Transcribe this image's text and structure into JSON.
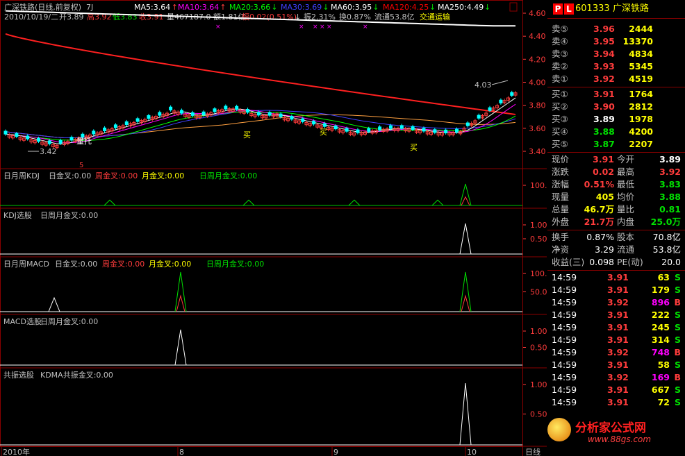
{
  "main": {
    "title": "广深铁路(日线,前复权)",
    "suffix": "7J",
    "ma_items": [
      {
        "label": "MA5:3.64",
        "color": "#ffffff",
        "arrow": "↑"
      },
      {
        "label": "MA10:3.64",
        "color": "#ff00ff",
        "arrow": "↑"
      },
      {
        "label": "MA20:3.66",
        "color": "#00ff00",
        "arrow": "↓"
      },
      {
        "label": "MA30:3.69",
        "color": "#0000ff",
        "arrow": "↓"
      },
      {
        "label": "MA60:3.95",
        "color": "#ffffff",
        "arrow": "↓"
      },
      {
        "label": "MA120:4.25",
        "color": "#ff0000",
        "arrow": "↓"
      },
      {
        "label": "MA250:4.49",
        "color": "#ffffff",
        "arrow": "↓"
      }
    ],
    "info_line": [
      {
        "text": "2010/10/19/二",
        "color": "#c0c0c0"
      },
      {
        "text": "开3.89",
        "color": "#c0c0c0"
      },
      {
        "text": "高3.92",
        "color": "#ff3c3c"
      },
      {
        "text": "低3.83",
        "color": "#00e000"
      },
      {
        "text": "收3.91",
        "color": "#ff3c3c"
      },
      {
        "text": "量467187.0",
        "color": "#c0c0c0"
      },
      {
        "text": "额1.81亿",
        "color": "#c0c0c0"
      },
      {
        "text": "幅0.02(0.51%)",
        "color": "#ff3c3c"
      },
      {
        "text": "↓",
        "color": "#c0c0c0"
      },
      {
        "text": "振2.31%",
        "color": "#c0c0c0"
      },
      {
        "text": "换0.87%",
        "color": "#c0c0c0"
      },
      {
        "text": "流通53.8亿",
        "color": "#c0c0c0"
      },
      {
        "text": "交通运输",
        "color": "#ffff00"
      }
    ],
    "y_ticks": [
      "4.60",
      "4.40",
      "4.20",
      "4.00",
      "3.80",
      "3.60",
      "3.40"
    ],
    "annotations": {
      "high": "4.03",
      "low": "3.42",
      "zhuo_tuo": "量托",
      "buy1": "买",
      "buy2": "买",
      "buy3": "买",
      "low_mark": "5"
    }
  },
  "panels": [
    {
      "title": "日月周KDJ",
      "items": [
        {
          "text": "日金叉:0.00",
          "color": "#c0c0c0"
        },
        {
          "text": "周金叉:0.00",
          "color": "#ff3c3c"
        },
        {
          "text": "月金叉:0.00",
          "color": "#ffff00"
        },
        {
          "text": "日周月金叉:0.00",
          "color": "#00e000"
        }
      ],
      "ticks": [
        "100.0"
      ]
    },
    {
      "title": "KDJ选股",
      "items": [
        {
          "text": "日周月金叉:0.00",
          "color": "#c0c0c0"
        }
      ],
      "ticks": [
        "1.00",
        "0.50"
      ]
    },
    {
      "title": "日月周MACD",
      "items": [
        {
          "text": "日金叉:0.00",
          "color": "#c0c0c0"
        },
        {
          "text": "周金叉:0.00",
          "color": "#ff3c3c"
        },
        {
          "text": "月金叉:0.00",
          "color": "#ffff00"
        },
        {
          "text": "日周月金叉:0.00",
          "color": "#00e000"
        }
      ],
      "ticks": [
        "100.0",
        "50.00"
      ]
    },
    {
      "title": "MACD选股",
      "items": [
        {
          "text": "日周月金叉:0.00",
          "color": "#c0c0c0"
        }
      ],
      "ticks": [
        "1.00",
        "0.50"
      ]
    },
    {
      "title": "共振选股",
      "items": [
        {
          "text": "KDMA共振金叉:0.00",
          "color": "#c0c0c0"
        }
      ],
      "ticks": [
        "1.00",
        "0.50"
      ]
    }
  ],
  "x_axis": {
    "labels": [
      "2010年",
      "8",
      "9",
      "10"
    ],
    "period": "日线"
  },
  "quote": {
    "badges": [
      "P",
      "L"
    ],
    "code": "601333",
    "name": "广深铁路",
    "asks": [
      {
        "label": "卖⑤",
        "price": "3.96",
        "vol": "2444"
      },
      {
        "label": "卖④",
        "price": "3.95",
        "vol": "13370"
      },
      {
        "label": "卖③",
        "price": "3.94",
        "vol": "4834"
      },
      {
        "label": "卖②",
        "price": "3.93",
        "vol": "5345"
      },
      {
        "label": "卖①",
        "price": "3.92",
        "vol": "4519"
      }
    ],
    "bids": [
      {
        "label": "买①",
        "price": "3.91",
        "vol": "1764",
        "pcolor": "#ff3c3c"
      },
      {
        "label": "买②",
        "price": "3.90",
        "vol": "2812",
        "pcolor": "#ff3c3c"
      },
      {
        "label": "买③",
        "price": "3.89",
        "vol": "1978",
        "pcolor": "#ffffff"
      },
      {
        "label": "买④",
        "price": "3.88",
        "vol": "4200",
        "pcolor": "#00e000"
      },
      {
        "label": "买⑤",
        "price": "3.87",
        "vol": "2207",
        "pcolor": "#00e000"
      }
    ],
    "stats": [
      [
        {
          "label": "现价",
          "value": "3.91",
          "vc": "#ff3c3c"
        },
        {
          "label": "今开",
          "value": "3.89",
          "vc": "#ffffff"
        }
      ],
      [
        {
          "label": "涨跌",
          "value": "0.02",
          "vc": "#ff3c3c"
        },
        {
          "label": "最高",
          "value": "3.92",
          "vc": "#ff3c3c"
        }
      ],
      [
        {
          "label": "涨幅",
          "value": "0.51%",
          "vc": "#ff3c3c"
        },
        {
          "label": "最低",
          "value": "3.83",
          "vc": "#00e000"
        }
      ],
      [
        {
          "label": "现量",
          "value": "405",
          "vc": "#ffff00"
        },
        {
          "label": "均价",
          "value": "3.88",
          "vc": "#00e000"
        }
      ],
      [
        {
          "label": "总量",
          "value": "46.7万",
          "vc": "#ffff00"
        },
        {
          "label": "量比",
          "value": "0.81",
          "vc": "#00e000"
        }
      ],
      [
        {
          "label": "外盘",
          "value": "21.7万",
          "vc": "#ff3c3c"
        },
        {
          "label": "内盘",
          "value": "25.0万",
          "vc": "#00e000"
        }
      ]
    ],
    "stats2": [
      [
        {
          "label": "换手",
          "value": "0.87%",
          "vc": "#ffffff"
        },
        {
          "label": "股本",
          "value": "70.8亿",
          "vc": "#ffffff"
        }
      ],
      [
        {
          "label": "净资",
          "value": "3.29",
          "vc": "#ffffff"
        },
        {
          "label": "流通",
          "value": "53.8亿",
          "vc": "#ffffff"
        }
      ],
      [
        {
          "label": "收益(三)",
          "value": "0.098",
          "vc": "#ffffff"
        },
        {
          "label": "PE(动)",
          "value": "20.0",
          "vc": "#ffffff"
        }
      ]
    ],
    "ticks": [
      {
        "time": "14:59",
        "price": "3.91",
        "vol": "63",
        "side": "S"
      },
      {
        "time": "14:59",
        "price": "3.91",
        "vol": "179",
        "side": "S"
      },
      {
        "time": "14:59",
        "price": "3.92",
        "vol": "896",
        "side": "B"
      },
      {
        "time": "14:59",
        "price": "3.91",
        "vol": "222",
        "side": "S"
      },
      {
        "time": "14:59",
        "price": "3.91",
        "vol": "245",
        "side": "S"
      },
      {
        "time": "14:59",
        "price": "3.91",
        "vol": "314",
        "side": "S"
      },
      {
        "time": "14:59",
        "price": "3.92",
        "vol": "748",
        "side": "B"
      },
      {
        "time": "14:59",
        "price": "3.91",
        "vol": "58",
        "side": "S"
      },
      {
        "time": "14:59",
        "price": "3.92",
        "vol": "169",
        "side": "B"
      },
      {
        "time": "14:59",
        "price": "3.91",
        "vol": "667",
        "side": "S"
      },
      {
        "time": "14:59",
        "price": "3.91",
        "vol": "72",
        "side": "S"
      }
    ],
    "watermark": {
      "name": "分析家公式网",
      "url": "www.88gs.com"
    }
  },
  "colors": {
    "up": "#ff3c3c",
    "down": "#00ffff",
    "ma120": "#ff2020",
    "ma250": "#ffffff",
    "border": "#8b0000",
    "yellow": "#ffff00"
  }
}
